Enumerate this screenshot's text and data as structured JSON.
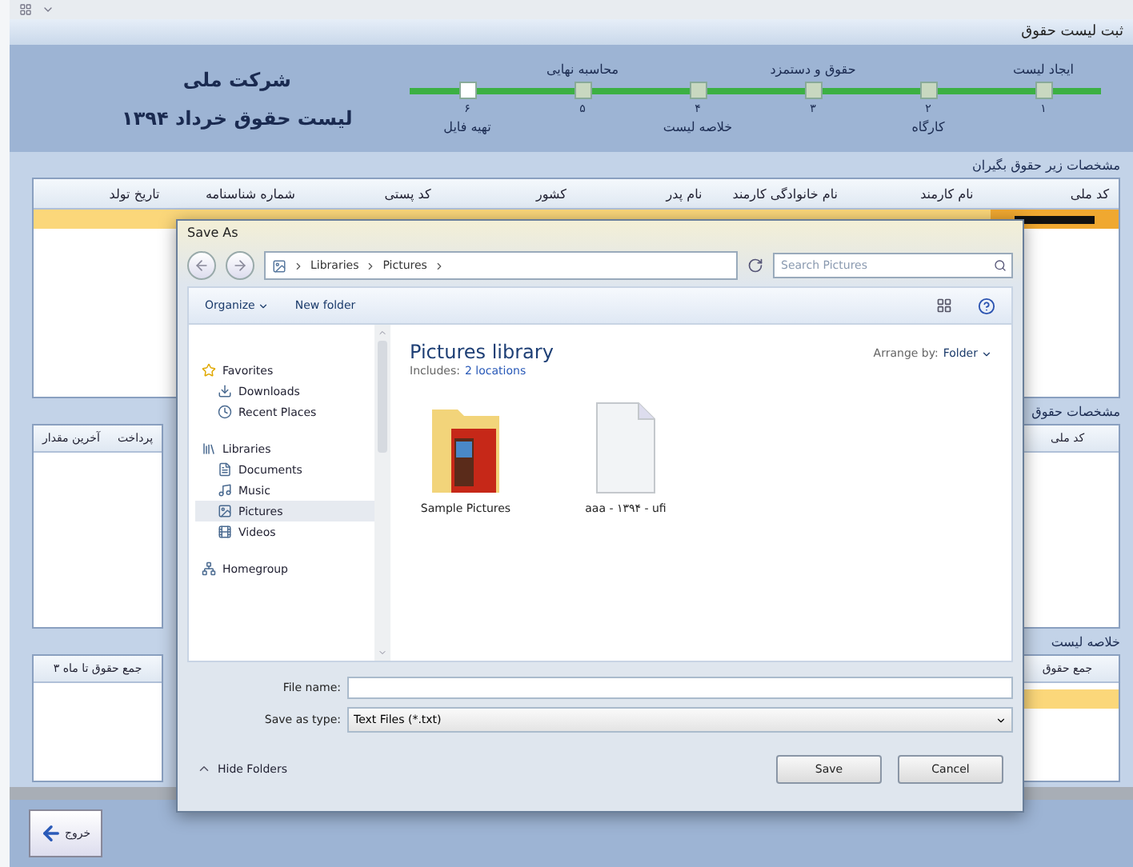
{
  "window": {
    "title": "ثبت لیست حقوق"
  },
  "company": {
    "name": "شرکت ملی",
    "list_title": "لیست حقوق خرداد ۱۳۹۴"
  },
  "steps": [
    {
      "label": "ایجاد لیست",
      "number": "۱",
      "completed": true
    },
    {
      "label": "کارگاه",
      "number": "۲",
      "completed": true
    },
    {
      "label": "حقوق و دستمزد",
      "number": "۳",
      "completed": true
    },
    {
      "label": "خلاصه لیست",
      "number": "۴",
      "completed": true
    },
    {
      "label": "محاسبه نهایی",
      "number": "۵",
      "completed": true
    },
    {
      "label": "تهیه فایل",
      "number": "۶",
      "completed": false
    }
  ],
  "employees_panel": {
    "title": "مشخصات زیر حقوق بگیران",
    "columns": [
      "کد ملی",
      "نام کارمند",
      "نام خانوادگی کارمند",
      "نام پدر",
      "کشور",
      "کد پستی",
      "شماره شناسنامه",
      "تاریخ تولد"
    ],
    "rows": [
      {
        "selected": true
      }
    ]
  },
  "salary_panel": {
    "title": "مشخصات حقوق",
    "right_column": "کد ملی",
    "left_columns": [
      "پرداخت",
      "آخرین مقدار"
    ]
  },
  "summary_panel": {
    "title": "خلاصه لیست",
    "right_column": "جمع حقوق",
    "left_column": "جمع حقوق تا ماه ۳"
  },
  "exit_button": "خروج",
  "dialog": {
    "title": "Save As",
    "breadcrumb": {
      "root": "Libraries",
      "current": "Pictures"
    },
    "search": {
      "placeholder": "Search Pictures"
    },
    "toolbar": {
      "organize": "Organize",
      "new_folder": "New folder"
    },
    "nav": [
      {
        "label": "Favorites",
        "kind": "group",
        "selected": false
      },
      {
        "label": "Downloads",
        "kind": "item",
        "selected": false
      },
      {
        "label": "Recent Places",
        "kind": "item",
        "selected": false
      },
      {
        "label": "Libraries",
        "kind": "group",
        "selected": false
      },
      {
        "label": "Documents",
        "kind": "item",
        "selected": false
      },
      {
        "label": "Music",
        "kind": "item",
        "selected": false
      },
      {
        "label": "Pictures",
        "kind": "item",
        "selected": true
      },
      {
        "label": "Videos",
        "kind": "item",
        "selected": false
      },
      {
        "label": "Homegroup",
        "kind": "group",
        "selected": false
      }
    ],
    "library": {
      "title": "Pictures library",
      "includes_label": "Includes:",
      "includes_value": "2 locations",
      "arrange_label": "Arrange by:",
      "arrange_value": "Folder"
    },
    "folder_item": {
      "name": "Sample Pictures",
      "kind": "folder"
    },
    "file_item": {
      "name": "aaa - ۱۳۹۴ - ufi",
      "kind": "file"
    },
    "file_name_label": "File name:",
    "type_label": "Save as type:",
    "type_value": "Text Files (*.txt)",
    "hide_folders": "Hide Folders",
    "save_button": "Save",
    "cancel_button": "Cancel"
  }
}
